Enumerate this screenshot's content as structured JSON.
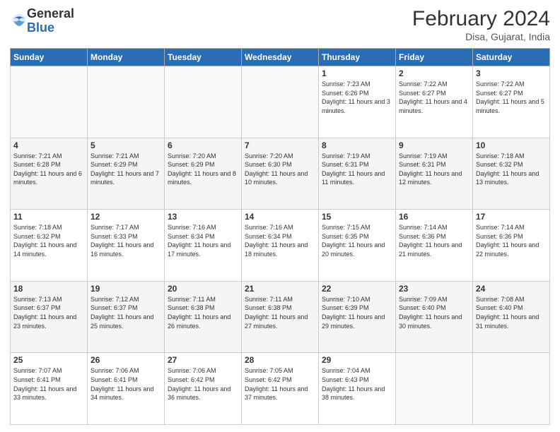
{
  "header": {
    "logo_general": "General",
    "logo_blue": "Blue",
    "month_year": "February 2024",
    "location": "Disa, Gujarat, India"
  },
  "days_of_week": [
    "Sunday",
    "Monday",
    "Tuesday",
    "Wednesday",
    "Thursday",
    "Friday",
    "Saturday"
  ],
  "weeks": [
    [
      {
        "day": "",
        "info": ""
      },
      {
        "day": "",
        "info": ""
      },
      {
        "day": "",
        "info": ""
      },
      {
        "day": "",
        "info": ""
      },
      {
        "day": "1",
        "info": "Sunrise: 7:23 AM\nSunset: 6:26 PM\nDaylight: 11 hours and 3 minutes."
      },
      {
        "day": "2",
        "info": "Sunrise: 7:22 AM\nSunset: 6:27 PM\nDaylight: 11 hours and 4 minutes."
      },
      {
        "day": "3",
        "info": "Sunrise: 7:22 AM\nSunset: 6:27 PM\nDaylight: 11 hours and 5 minutes."
      }
    ],
    [
      {
        "day": "4",
        "info": "Sunrise: 7:21 AM\nSunset: 6:28 PM\nDaylight: 11 hours and 6 minutes."
      },
      {
        "day": "5",
        "info": "Sunrise: 7:21 AM\nSunset: 6:29 PM\nDaylight: 11 hours and 7 minutes."
      },
      {
        "day": "6",
        "info": "Sunrise: 7:20 AM\nSunset: 6:29 PM\nDaylight: 11 hours and 8 minutes."
      },
      {
        "day": "7",
        "info": "Sunrise: 7:20 AM\nSunset: 6:30 PM\nDaylight: 11 hours and 10 minutes."
      },
      {
        "day": "8",
        "info": "Sunrise: 7:19 AM\nSunset: 6:31 PM\nDaylight: 11 hours and 11 minutes."
      },
      {
        "day": "9",
        "info": "Sunrise: 7:19 AM\nSunset: 6:31 PM\nDaylight: 11 hours and 12 minutes."
      },
      {
        "day": "10",
        "info": "Sunrise: 7:18 AM\nSunset: 6:32 PM\nDaylight: 11 hours and 13 minutes."
      }
    ],
    [
      {
        "day": "11",
        "info": "Sunrise: 7:18 AM\nSunset: 6:32 PM\nDaylight: 11 hours and 14 minutes."
      },
      {
        "day": "12",
        "info": "Sunrise: 7:17 AM\nSunset: 6:33 PM\nDaylight: 11 hours and 16 minutes."
      },
      {
        "day": "13",
        "info": "Sunrise: 7:16 AM\nSunset: 6:34 PM\nDaylight: 11 hours and 17 minutes."
      },
      {
        "day": "14",
        "info": "Sunrise: 7:16 AM\nSunset: 6:34 PM\nDaylight: 11 hours and 18 minutes."
      },
      {
        "day": "15",
        "info": "Sunrise: 7:15 AM\nSunset: 6:35 PM\nDaylight: 11 hours and 20 minutes."
      },
      {
        "day": "16",
        "info": "Sunrise: 7:14 AM\nSunset: 6:36 PM\nDaylight: 11 hours and 21 minutes."
      },
      {
        "day": "17",
        "info": "Sunrise: 7:14 AM\nSunset: 6:36 PM\nDaylight: 11 hours and 22 minutes."
      }
    ],
    [
      {
        "day": "18",
        "info": "Sunrise: 7:13 AM\nSunset: 6:37 PM\nDaylight: 11 hours and 23 minutes."
      },
      {
        "day": "19",
        "info": "Sunrise: 7:12 AM\nSunset: 6:37 PM\nDaylight: 11 hours and 25 minutes."
      },
      {
        "day": "20",
        "info": "Sunrise: 7:11 AM\nSunset: 6:38 PM\nDaylight: 11 hours and 26 minutes."
      },
      {
        "day": "21",
        "info": "Sunrise: 7:11 AM\nSunset: 6:38 PM\nDaylight: 11 hours and 27 minutes."
      },
      {
        "day": "22",
        "info": "Sunrise: 7:10 AM\nSunset: 6:39 PM\nDaylight: 11 hours and 29 minutes."
      },
      {
        "day": "23",
        "info": "Sunrise: 7:09 AM\nSunset: 6:40 PM\nDaylight: 11 hours and 30 minutes."
      },
      {
        "day": "24",
        "info": "Sunrise: 7:08 AM\nSunset: 6:40 PM\nDaylight: 11 hours and 31 minutes."
      }
    ],
    [
      {
        "day": "25",
        "info": "Sunrise: 7:07 AM\nSunset: 6:41 PM\nDaylight: 11 hours and 33 minutes."
      },
      {
        "day": "26",
        "info": "Sunrise: 7:06 AM\nSunset: 6:41 PM\nDaylight: 11 hours and 34 minutes."
      },
      {
        "day": "27",
        "info": "Sunrise: 7:06 AM\nSunset: 6:42 PM\nDaylight: 11 hours and 36 minutes."
      },
      {
        "day": "28",
        "info": "Sunrise: 7:05 AM\nSunset: 6:42 PM\nDaylight: 11 hours and 37 minutes."
      },
      {
        "day": "29",
        "info": "Sunrise: 7:04 AM\nSunset: 6:43 PM\nDaylight: 11 hours and 38 minutes."
      },
      {
        "day": "",
        "info": ""
      },
      {
        "day": "",
        "info": ""
      }
    ]
  ]
}
